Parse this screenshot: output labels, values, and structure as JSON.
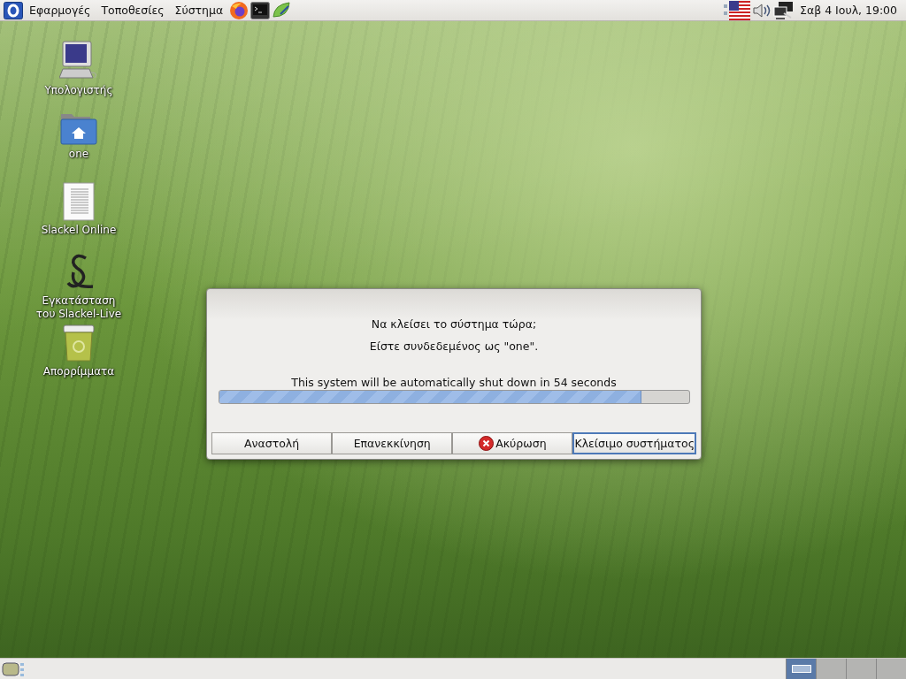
{
  "top_panel": {
    "menus": [
      "Εφαρμογές",
      "Τοποθεσίες",
      "Σύστημα"
    ],
    "clock": "Σαβ  4 Ιουλ, 19:00"
  },
  "desktop_icons": [
    {
      "kind": "computer",
      "label": "Υπολογιστής"
    },
    {
      "kind": "home",
      "label": "one"
    },
    {
      "kind": "document",
      "label": "Slackel Online"
    },
    {
      "kind": "installer",
      "label": "Εγκατάσταση του Slackel-Live"
    },
    {
      "kind": "trash",
      "label": "Απορρίμματα"
    }
  ],
  "dialog": {
    "question": "Να κλείσει το σύστημα τώρα;",
    "logged_in": "Είστε συνδεδεμένος ως  \"one\".",
    "countdown": "This system will be automatically shut down in 54 seconds",
    "progress": {
      "level": 0.9
    },
    "buttons": [
      {
        "label": "Αναστολή",
        "kind": "plain",
        "focused": false
      },
      {
        "label": "Επανεκκίνηση",
        "kind": "plain",
        "focused": false
      },
      {
        "label": "Ακύρωση",
        "kind": "cancel",
        "focused": false
      },
      {
        "label": "Κλείσιμο συστήματος",
        "kind": "plain",
        "focused": true
      }
    ]
  },
  "bottom_panel": {
    "workspaces": [
      {
        "selected": true
      },
      {
        "selected": false
      },
      {
        "selected": false
      },
      {
        "selected": false
      }
    ]
  }
}
